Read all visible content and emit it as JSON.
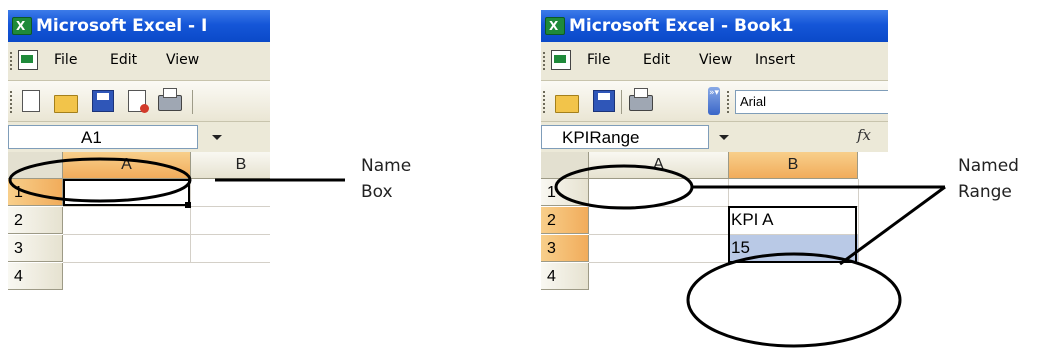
{
  "left_window": {
    "title": "Microsoft Excel - I",
    "menu": [
      "File",
      "Edit",
      "View"
    ],
    "namebox_value": "A1",
    "columns": [
      "A",
      "B"
    ],
    "rows": [
      "1",
      "2",
      "3",
      "4"
    ]
  },
  "right_window": {
    "title": "Microsoft Excel - Book1",
    "menu": [
      "File",
      "Edit",
      "View",
      "Insert"
    ],
    "font_name": "Arial",
    "namebox_value": "KPIRange",
    "columns": [
      "A",
      "B"
    ],
    "rows": [
      "1",
      "2",
      "3",
      "4"
    ],
    "cells": {
      "B2": "KPI A",
      "B3": "15"
    }
  },
  "annotations": {
    "name_box": [
      "Name",
      "Box"
    ],
    "named_range": [
      "Named",
      "Range"
    ]
  },
  "colors": {
    "titlebar": "#0a49c8",
    "active_header": "#f1ac5b",
    "selection_fill": "#b9c9e6"
  }
}
